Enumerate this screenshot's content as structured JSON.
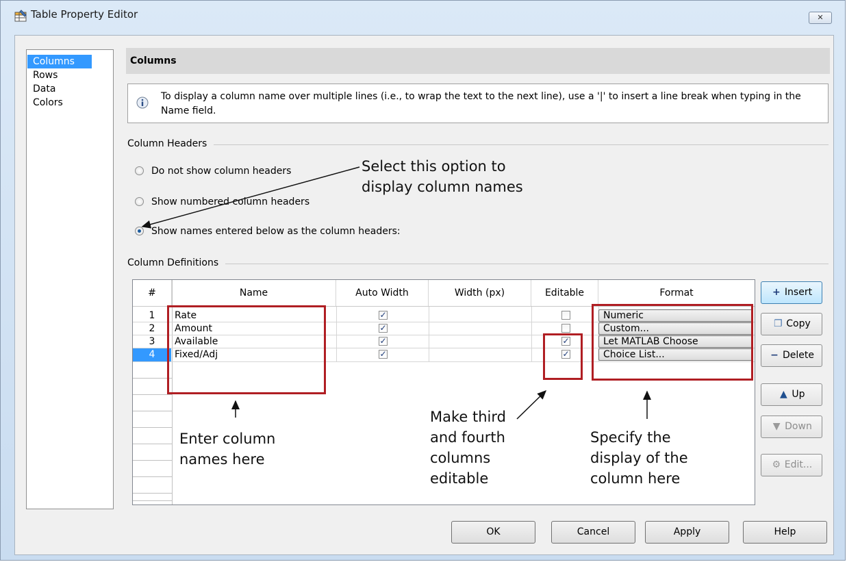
{
  "window": {
    "title": "Table Property Editor",
    "close_label": "✕"
  },
  "nav": {
    "items": [
      {
        "label": "Columns",
        "selected": true
      },
      {
        "label": "Rows",
        "selected": false
      },
      {
        "label": "Data",
        "selected": false
      },
      {
        "label": "Colors",
        "selected": false
      }
    ]
  },
  "section": {
    "title": "Columns"
  },
  "info": {
    "text": "To display a column name over multiple lines (i.e., to wrap the text to the next line), use a '|' to insert a line break when typing in the Name field."
  },
  "headers_group": {
    "title": "Column Headers",
    "options": [
      {
        "label": "Do not show column headers",
        "selected": false
      },
      {
        "label": "Show numbered column headers",
        "selected": false
      },
      {
        "label": "Show names entered below as the column headers:",
        "selected": true
      }
    ]
  },
  "definitions_group": {
    "title": "Column Definitions"
  },
  "table": {
    "columns": [
      "#",
      "Name",
      "Auto Width",
      "Width (px)",
      "Editable",
      "Format"
    ],
    "rows": [
      {
        "num": "1",
        "name": "Rate",
        "auto_width": true,
        "width": "",
        "editable": false,
        "format": "Numeric"
      },
      {
        "num": "2",
        "name": "Amount",
        "auto_width": true,
        "width": "",
        "editable": false,
        "format": "Custom..."
      },
      {
        "num": "3",
        "name": "Available",
        "auto_width": true,
        "width": "",
        "editable": true,
        "format": "Let MATLAB Choose"
      },
      {
        "num": "4",
        "name": "Fixed/Adj",
        "auto_width": true,
        "width": "",
        "editable": true,
        "format": "Choice List..."
      }
    ],
    "selected_row": "4"
  },
  "side_buttons": {
    "insert": "Insert",
    "copy": "Copy",
    "delete": "Delete",
    "up": "Up",
    "down": "Down",
    "edit": "Edit..."
  },
  "bottom_buttons": {
    "ok": "OK",
    "cancel": "Cancel",
    "apply": "Apply",
    "help": "Help"
  },
  "annotations": {
    "select_option": [
      "Select this option to",
      "display column names"
    ],
    "enter_names": [
      "Enter column",
      "names here"
    ],
    "make_editable": [
      "Make third",
      "and fourth",
      "columns",
      "editable"
    ],
    "specify_display": [
      "Specify the",
      "display of the",
      "column here"
    ]
  },
  "colors": {
    "accent": "#3399ff",
    "annotation_box": "#b01e23"
  }
}
